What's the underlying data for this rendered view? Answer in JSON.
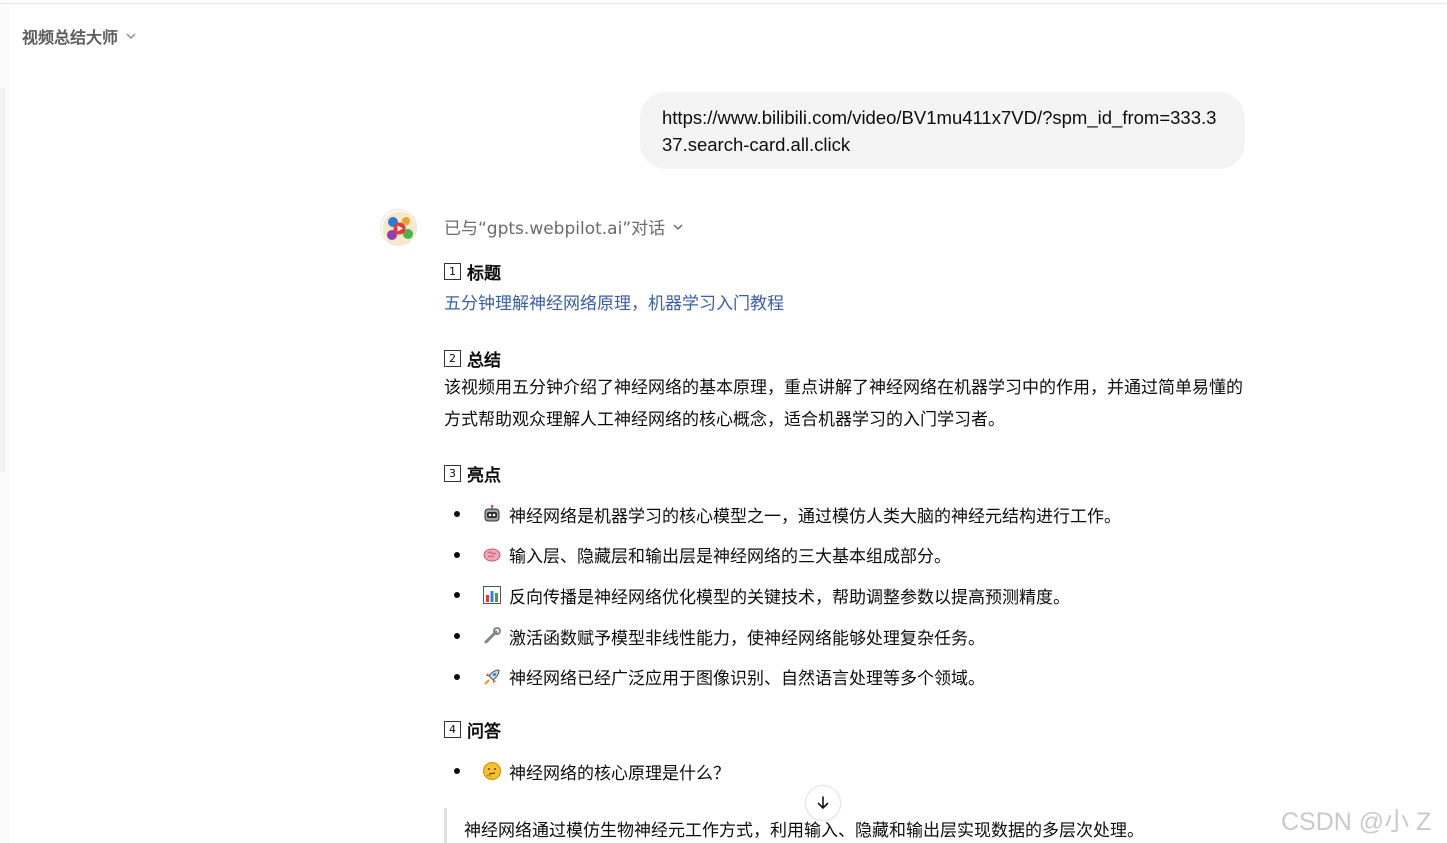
{
  "header": {
    "app_title": "视频总结大师"
  },
  "user_message": {
    "text": "https://www.bilibili.com/video/BV1mu411x7VD/?spm_id_from=333.337.search-card.all.click"
  },
  "assistant": {
    "tool_status": "已与“gpts.webpilot.ai”对话",
    "sections": {
      "title": {
        "num": "1",
        "heading": "标题",
        "link_text": "五分钟理解神经网络原理，机器学习入门教程"
      },
      "summary": {
        "num": "2",
        "heading": "总结",
        "text": "该视频用五分钟介绍了神经网络的基本原理，重点讲解了神经网络在机器学习中的作用，并通过简单易懂的方式帮助观众理解人工神经网络的核心概念，适合机器学习的入门学习者。"
      },
      "highlights": {
        "num": "3",
        "heading": "亮点",
        "items": [
          {
            "icon": "robot-icon",
            "text": "神经网络是机器学习的核心模型之一，通过模仿人类大脑的神经元结构进行工作。"
          },
          {
            "icon": "brain-icon",
            "text": "输入层、隐藏层和输出层是神经网络的三大基本组成部分。"
          },
          {
            "icon": "bar-chart-icon",
            "text": "反向传播是神经网络优化模型的关键技术，帮助调整参数以提高预测精度。"
          },
          {
            "icon": "wrench-icon",
            "text": "激活函数赋予模型非线性能力，使神经网络能够处理复杂任务。"
          },
          {
            "icon": "rocket-icon",
            "text": "神经网络已经广泛应用于图像识别、自然语言处理等多个领域。"
          }
        ]
      },
      "qa": {
        "num": "4",
        "heading": "问答",
        "items": [
          {
            "icon": "thinking-face-icon",
            "text": "神经网络的核心原理是什么？"
          }
        ],
        "answer": "神经网络通过模仿生物神经元工作方式，利用输入、隐藏和输出层实现数据的多层次处理。"
      }
    }
  },
  "watermark": "CSDN @小 Z",
  "colors": {
    "link": "#3a5fa3",
    "bubble": "#f4f4f4",
    "muted": "#6b6b6b"
  }
}
